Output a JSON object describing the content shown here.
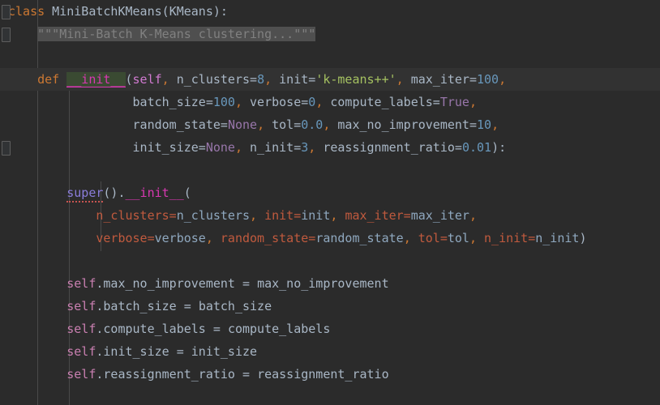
{
  "editor": {
    "language": "Python",
    "theme": "Darcula",
    "background": "#2b2b2b",
    "default_text_color": "#a9b7c6",
    "current_line_background": "#323232",
    "selection_background": "#4f4f4f"
  },
  "gutter": {
    "fold_markers": [
      "fold-marker-class",
      "fold-marker-docstring",
      "fold-marker-init-signature"
    ]
  },
  "colors": {
    "keyword": "#cc7832",
    "string": "#a5c261",
    "number": "#6897bb",
    "constant": "#9876aa",
    "self": "#d17ad1",
    "function_def": "#d838b2",
    "super": "#8a7ddb",
    "kwarg_name": "#c05a3e",
    "docstring": "#808080",
    "error_squiggle": "#c75450",
    "indent_guide": "#4a4a4a"
  },
  "code": {
    "line_01": {
      "kw_class": "class",
      "class_name": " MiniBatchKMeans",
      "open_paren": "(",
      "base_class": "KMeans",
      "close_colon": "):"
    },
    "line_02": {
      "indent": "    ",
      "docstring": "\"\"\"Mini-Batch K-Means clustering...\"\"\""
    },
    "line_04": {
      "indent": "    ",
      "kw_def": "def",
      "space": " ",
      "func_name": "__init__",
      "open_paren": "(",
      "p_self": "self",
      "sep1": ", ",
      "p_n_clusters": "n_clusters=",
      "v_n_clusters": "8",
      "sep2": ", ",
      "p_init": "init=",
      "v_init": "'k-means++'",
      "sep3": ", ",
      "p_max_iter": "max_iter=",
      "v_max_iter": "100",
      "sep4": ","
    },
    "line_05": {
      "indent": "                 ",
      "p_batch_size": "batch_size=",
      "v_batch_size": "100",
      "sep1": ", ",
      "p_verbose": "verbose=",
      "v_verbose": "0",
      "sep2": ", ",
      "p_compute_labels": "compute_labels=",
      "v_compute_labels": "True",
      "sep3": ","
    },
    "line_06": {
      "indent": "                 ",
      "p_random_state": "random_state=",
      "v_random_state": "None",
      "sep1": ", ",
      "p_tol": "tol=",
      "v_tol": "0.0",
      "sep2": ", ",
      "p_max_no_improvement": "max_no_improvement=",
      "v_max_no_improvement": "10",
      "sep3": ","
    },
    "line_07": {
      "indent": "                 ",
      "p_init_size": "init_size=",
      "v_init_size": "None",
      "sep1": ", ",
      "p_n_init": "n_init=",
      "v_n_init": "3",
      "sep2": ", ",
      "p_reassignment_ratio": "reassignment_ratio=",
      "v_reassignment_ratio": "0.01",
      "close": "):"
    },
    "line_09": {
      "indent": "        ",
      "super_call": "super",
      "parens": "().",
      "init_name": "__init__",
      "open_paren": "("
    },
    "line_10": {
      "indent": "            ",
      "k_n_clusters": "n_clusters=",
      "v_n_clusters": "n_clusters",
      "sep1": ", ",
      "k_init": "init=",
      "v_init": "init",
      "sep2": ", ",
      "k_max_iter": "max_iter=",
      "v_max_iter": "max_iter",
      "sep3": ","
    },
    "line_11": {
      "indent": "            ",
      "k_verbose": "verbose=",
      "v_verbose": "verbose",
      "sep1": ", ",
      "k_random_state": "random_state=",
      "v_random_state": "random_state",
      "sep2": ", ",
      "k_tol": "tol=",
      "v_tol": "tol",
      "sep3": ", ",
      "k_n_init": "n_init=",
      "v_n_init": "n_init",
      "close": ")"
    },
    "line_13": {
      "indent": "        ",
      "self": "self",
      "attr": ".max_no_improvement ",
      "eq": "= ",
      "value": "max_no_improvement"
    },
    "line_14": {
      "indent": "        ",
      "self": "self",
      "attr": ".batch_size ",
      "eq": "= ",
      "value": "batch_size"
    },
    "line_15": {
      "indent": "        ",
      "self": "self",
      "attr": ".compute_labels ",
      "eq": "= ",
      "value": "compute_labels"
    },
    "line_16": {
      "indent": "        ",
      "self": "self",
      "attr": ".init_size ",
      "eq": "= ",
      "value": "init_size"
    },
    "line_17": {
      "indent": "        ",
      "self": "self",
      "attr": ".reassignment_ratio ",
      "eq": "= ",
      "value": "reassignment_ratio"
    }
  }
}
